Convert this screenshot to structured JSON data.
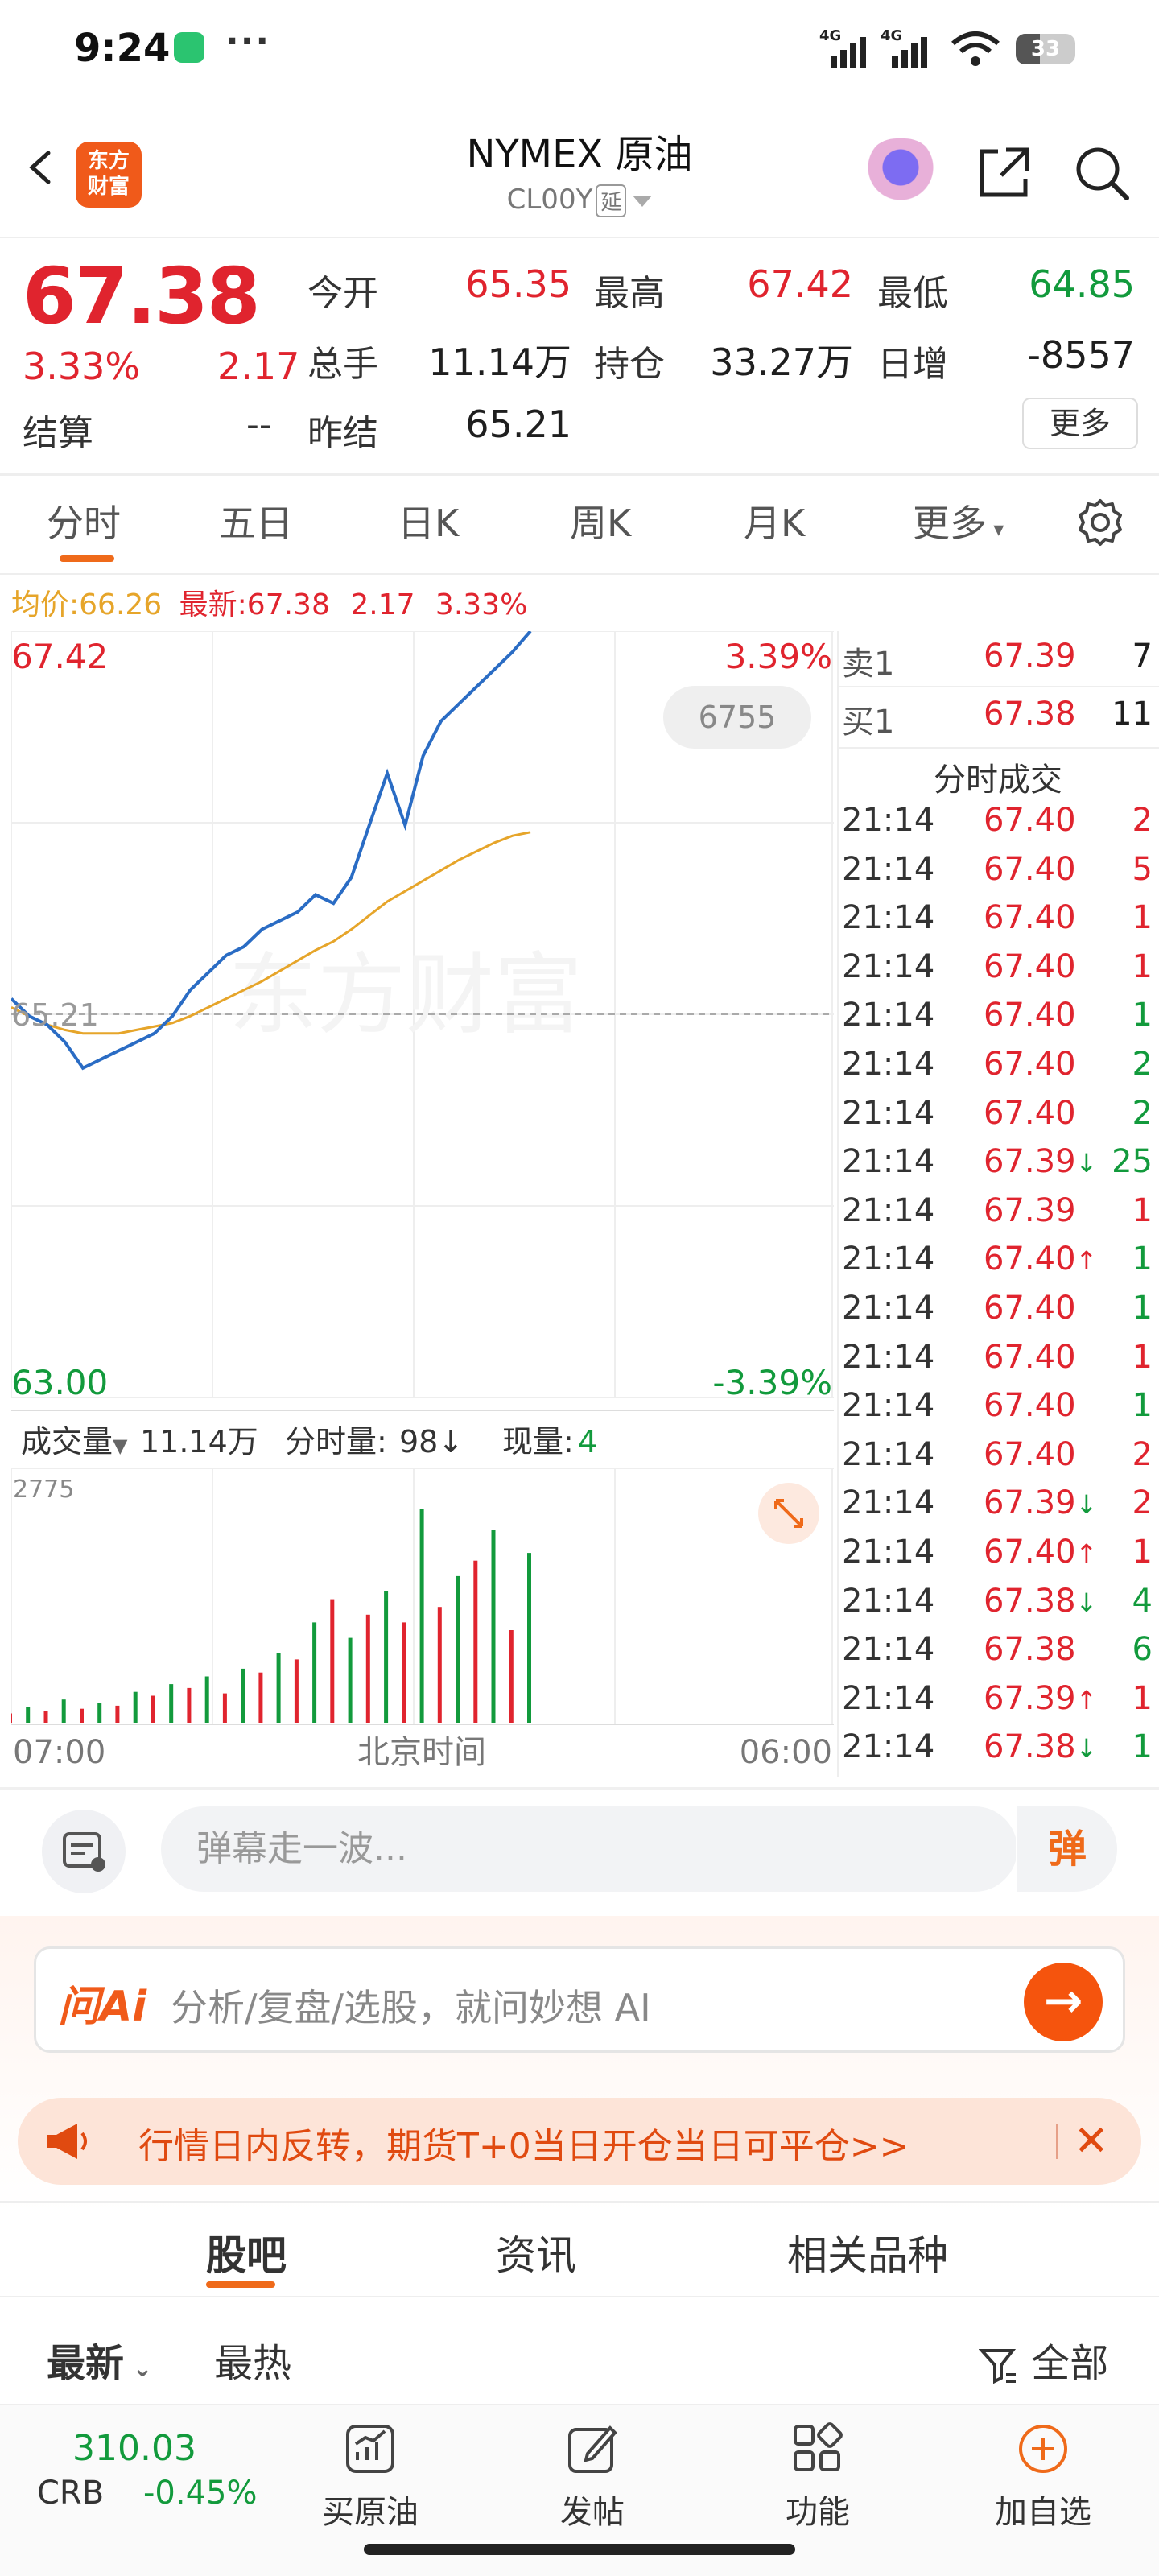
{
  "status_bar": {
    "time": "9:24",
    "dots": "···",
    "sig1": "4G",
    "sig2": "4G",
    "battery": "33"
  },
  "header": {
    "title": "NYMEX 原油",
    "code": "CL00Y",
    "delay_tag": "延",
    "logo_line1": "东方",
    "logo_line2": "财富"
  },
  "quote": {
    "price": "67.38",
    "change_pct": "3.33%",
    "change": "2.17",
    "settle_label": "结算",
    "settle_value": "--",
    "open_label": "今开",
    "open_value": "65.35",
    "high_label": "最高",
    "high_value": "67.42",
    "low_label": "最低",
    "low_value": "64.85",
    "volume_label": "总手",
    "volume_value": "11.14万",
    "oi_label": "持仓",
    "oi_value": "33.27万",
    "daily_inc_label": "日增",
    "daily_inc_value": "-8557",
    "prev_settle_label": "昨结",
    "prev_settle_value": "65.21",
    "more": "更多"
  },
  "tabs": [
    "分时",
    "五日",
    "日K",
    "周K",
    "月K",
    "更多"
  ],
  "infobar": {
    "avg_label": "均价:",
    "avg_value": "66.26",
    "latest_label": "最新:",
    "latest_value": "67.38",
    "chg": "2.17",
    "pct": "3.33%"
  },
  "chart": {
    "y_top": "67.42",
    "y_bottom": "63.00",
    "y_mid": "65.21",
    "pct_top": "3.39%",
    "pct_bottom": "-3.39%",
    "badge": "6755",
    "watermark": "东方财富",
    "vol_label": "成交量",
    "vol_value": "11.14万",
    "tick_vol_label": "分时量:",
    "tick_vol_value": "98",
    "tick_vol_arrow": "↓",
    "cur_vol_label": "现量:",
    "cur_vol_value": "4",
    "vol_max": "2775",
    "x_start": "07:00",
    "x_mid": "北京时间",
    "x_end": "06:00"
  },
  "chart_data": {
    "type": "line",
    "title": "",
    "x": [
      "07:00",
      "+0.5h",
      "+1h",
      "+1.5h",
      "+2h",
      "+2.5h",
      "+3h",
      "+3.5h",
      "+4h",
      "+4.5h",
      "+5h",
      "+5.5h",
      "+6h",
      "+6.5h",
      "+7h",
      "+7.5h",
      "+8h",
      "+8.5h",
      "+9h",
      "+9.5h",
      "+10h",
      "+10.5h",
      "+11h",
      "+11.5h",
      "+12h",
      "+12.5h",
      "+13h",
      "+13.5h",
      "+14h",
      "+14.2h"
    ],
    "series": [
      {
        "values": [
          65.3,
          65.2,
          65.15,
          65.05,
          64.9,
          64.95,
          65.0,
          65.05,
          65.1,
          65.2,
          65.35,
          65.45,
          65.55,
          65.6,
          65.7,
          65.75,
          65.8,
          65.9,
          65.85,
          66.0,
          66.3,
          66.6,
          66.3,
          66.7,
          66.9,
          67.0,
          67.1,
          67.2,
          67.3,
          67.42
        ]
      },
      {
        "values": [
          65.25,
          65.2,
          65.15,
          65.12,
          65.1,
          65.1,
          65.1,
          65.12,
          65.14,
          65.16,
          65.2,
          65.25,
          65.3,
          65.35,
          65.4,
          65.46,
          65.52,
          65.58,
          65.63,
          65.7,
          65.78,
          65.86,
          65.92,
          65.98,
          66.04,
          66.1,
          66.15,
          66.2,
          66.24,
          66.26
        ]
      }
    ],
    "volume": [
      120,
      200,
      150,
      300,
      180,
      260,
      220,
      400,
      350,
      500,
      450,
      600,
      380,
      700,
      650,
      900,
      820,
      1300,
      1600,
      1100,
      1400,
      1700,
      1300,
      2775,
      1500,
      1900,
      2100,
      2500,
      1200,
      2200
    ],
    "ylim": [
      63.0,
      67.42
    ],
    "ref_line": 65.21,
    "vol_max": 2775
  },
  "order_book": {
    "ask_label": "卖1",
    "ask_price": "67.39",
    "ask_vol": "7",
    "bid_label": "买1",
    "bid_price": "67.38",
    "bid_vol": "11",
    "title": "分时成交",
    "trades": [
      {
        "t": "21:14",
        "p": "67.40",
        "a": "",
        "v": "2",
        "c": "red"
      },
      {
        "t": "21:14",
        "p": "67.40",
        "a": "",
        "v": "5",
        "c": "red"
      },
      {
        "t": "21:14",
        "p": "67.40",
        "a": "",
        "v": "1",
        "c": "red"
      },
      {
        "t": "21:14",
        "p": "67.40",
        "a": "",
        "v": "1",
        "c": "red"
      },
      {
        "t": "21:14",
        "p": "67.40",
        "a": "",
        "v": "1",
        "c": "green"
      },
      {
        "t": "21:14",
        "p": "67.40",
        "a": "",
        "v": "2",
        "c": "green"
      },
      {
        "t": "21:14",
        "p": "67.40",
        "a": "",
        "v": "2",
        "c": "green"
      },
      {
        "t": "21:14",
        "p": "67.39",
        "a": "↓",
        "v": "25",
        "c": "green"
      },
      {
        "t": "21:14",
        "p": "67.39",
        "a": "",
        "v": "1",
        "c": "red"
      },
      {
        "t": "21:14",
        "p": "67.40",
        "a": "↑",
        "v": "1",
        "c": "green"
      },
      {
        "t": "21:14",
        "p": "67.40",
        "a": "",
        "v": "1",
        "c": "green"
      },
      {
        "t": "21:14",
        "p": "67.40",
        "a": "",
        "v": "1",
        "c": "red"
      },
      {
        "t": "21:14",
        "p": "67.40",
        "a": "",
        "v": "1",
        "c": "green"
      },
      {
        "t": "21:14",
        "p": "67.40",
        "a": "",
        "v": "2",
        "c": "red"
      },
      {
        "t": "21:14",
        "p": "67.39",
        "a": "↓",
        "v": "2",
        "c": "red"
      },
      {
        "t": "21:14",
        "p": "67.40",
        "a": "↑",
        "v": "1",
        "c": "red"
      },
      {
        "t": "21:14",
        "p": "67.38",
        "a": "↓",
        "v": "4",
        "c": "green"
      },
      {
        "t": "21:14",
        "p": "67.38",
        "a": "",
        "v": "6",
        "c": "green"
      },
      {
        "t": "21:14",
        "p": "67.39",
        "a": "↑",
        "v": "1",
        "c": "red"
      },
      {
        "t": "21:14",
        "p": "67.38",
        "a": "↓",
        "v": "1",
        "c": "green"
      }
    ]
  },
  "danmu": {
    "placeholder": "弹幕走一波...",
    "button": "弹"
  },
  "ai": {
    "logo": "问Ai",
    "placeholder": "分析/复盘/选股，就问妙想 AI",
    "go": "→"
  },
  "promo": {
    "text": "行情日内反转，期货T+0当日开仓当日可平仓>>",
    "close": "✕"
  },
  "sub_tabs": [
    "股吧",
    "资讯",
    "相关品种"
  ],
  "filters": {
    "latest": "最新",
    "hot": "最热",
    "all": "全部"
  },
  "bottom_nav": {
    "index_value": "310.03",
    "index_name": "CRB",
    "index_chg": "-0.45%",
    "buy": "买原油",
    "post": "发帖",
    "func": "功能",
    "add": "加自选"
  },
  "colors": {
    "up": "#e0242e",
    "down": "#129a3c",
    "accent": "#ef6a1a",
    "line": "#2a6cc4",
    "avg": "#e6a52a"
  }
}
